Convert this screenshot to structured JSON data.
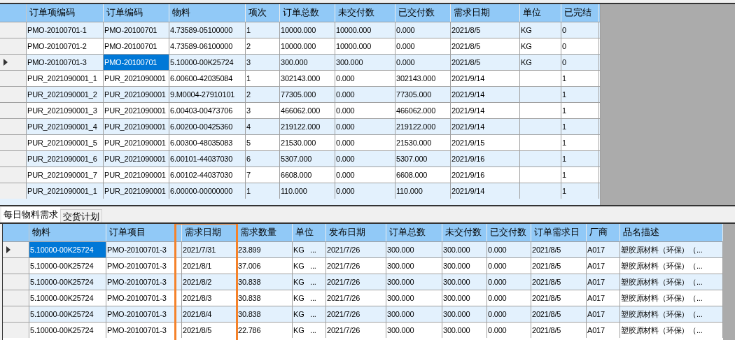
{
  "orders_grid": {
    "columns": [
      {
        "label": "订单项编码"
      },
      {
        "label": "订单编码"
      },
      {
        "label": "物料"
      },
      {
        "label": "项次"
      },
      {
        "label": "订单总数"
      },
      {
        "label": "未交付数"
      },
      {
        "label": "已交付数"
      },
      {
        "label": "需求日期"
      },
      {
        "label": "单位"
      },
      {
        "label": "已完结"
      }
    ],
    "rows": [
      {
        "selected": false,
        "cells": [
          {
            "text": "PMO-20100701-1",
            "selected": false
          },
          {
            "text": "PMO-20100701",
            "selected": false
          },
          {
            "text": "4.73589-05100000",
            "selected": false
          },
          {
            "text": "1",
            "selected": false
          },
          {
            "text": "10000.000",
            "selected": false
          },
          {
            "text": "10000.000",
            "selected": false
          },
          {
            "text": "0.000",
            "selected": false
          },
          {
            "text": "2021/8/5",
            "selected": false
          },
          {
            "text": "KG",
            "selected": false
          },
          {
            "text": "0",
            "selected": false
          }
        ]
      },
      {
        "selected": false,
        "cells": [
          {
            "text": "PMO-20100701-2",
            "selected": false
          },
          {
            "text": "PMO-20100701",
            "selected": false
          },
          {
            "text": "4.73589-06100000",
            "selected": false
          },
          {
            "text": "2",
            "selected": false
          },
          {
            "text": "10000.000",
            "selected": false
          },
          {
            "text": "10000.000",
            "selected": false
          },
          {
            "text": "0.000",
            "selected": false
          },
          {
            "text": "2021/8/5",
            "selected": false
          },
          {
            "text": "KG",
            "selected": false
          },
          {
            "text": "0",
            "selected": false
          }
        ]
      },
      {
        "selected": true,
        "cells": [
          {
            "text": "PMO-20100701-3",
            "selected": false
          },
          {
            "text": "PMO-20100701",
            "selected": true
          },
          {
            "text": "5.10000-00K25724",
            "selected": false
          },
          {
            "text": "3",
            "selected": false
          },
          {
            "text": "300.000",
            "selected": false
          },
          {
            "text": "300.000",
            "selected": false
          },
          {
            "text": "0.000",
            "selected": false
          },
          {
            "text": "2021/8/5",
            "selected": false
          },
          {
            "text": "KG",
            "selected": false
          },
          {
            "text": "0",
            "selected": false
          }
        ]
      },
      {
        "selected": false,
        "cells": [
          {
            "text": "PUR_2021090001_1",
            "selected": false
          },
          {
            "text": "PUR_2021090001",
            "selected": false
          },
          {
            "text": "6.00600-42035084",
            "selected": false
          },
          {
            "text": "1",
            "selected": false
          },
          {
            "text": "302143.000",
            "selected": false
          },
          {
            "text": "0.000",
            "selected": false
          },
          {
            "text": "302143.000",
            "selected": false
          },
          {
            "text": "2021/9/14",
            "selected": false
          },
          {
            "selected": false
          },
          {
            "text": "1",
            "selected": false
          }
        ]
      },
      {
        "selected": false,
        "cells": [
          {
            "text": "PUR_2021090001_2",
            "selected": false
          },
          {
            "text": "PUR_2021090001",
            "selected": false
          },
          {
            "text": "9.M0004-27910101",
            "selected": false
          },
          {
            "text": "2",
            "selected": false
          },
          {
            "text": "77305.000",
            "selected": false
          },
          {
            "text": "0.000",
            "selected": false
          },
          {
            "text": "77305.000",
            "selected": false
          },
          {
            "text": "2021/9/14",
            "selected": false
          },
          {
            "selected": false
          },
          {
            "text": "1",
            "selected": false
          }
        ]
      },
      {
        "selected": false,
        "cells": [
          {
            "text": "PUR_2021090001_3",
            "selected": false
          },
          {
            "text": "PUR_2021090001",
            "selected": false
          },
          {
            "text": "6.00403-00473706",
            "selected": false
          },
          {
            "text": "3",
            "selected": false
          },
          {
            "text": "466062.000",
            "selected": false
          },
          {
            "text": "0.000",
            "selected": false
          },
          {
            "text": "466062.000",
            "selected": false
          },
          {
            "text": "2021/9/14",
            "selected": false
          },
          {
            "selected": false
          },
          {
            "text": "1",
            "selected": false
          }
        ]
      },
      {
        "selected": false,
        "cells": [
          {
            "text": "PUR_2021090001_4",
            "selected": false
          },
          {
            "text": "PUR_2021090001",
            "selected": false
          },
          {
            "text": "6.00200-00425360",
            "selected": false
          },
          {
            "text": "4",
            "selected": false
          },
          {
            "text": "219122.000",
            "selected": false
          },
          {
            "text": "0.000",
            "selected": false
          },
          {
            "text": "219122.000",
            "selected": false
          },
          {
            "text": "2021/9/14",
            "selected": false
          },
          {
            "selected": false
          },
          {
            "text": "1",
            "selected": false
          }
        ]
      },
      {
        "selected": false,
        "cells": [
          {
            "text": "PUR_2021090001_5",
            "selected": false
          },
          {
            "text": "PUR_2021090001",
            "selected": false
          },
          {
            "text": "6.00300-48035083",
            "selected": false
          },
          {
            "text": "5",
            "selected": false
          },
          {
            "text": "21530.000",
            "selected": false
          },
          {
            "text": "0.000",
            "selected": false
          },
          {
            "text": "21530.000",
            "selected": false
          },
          {
            "text": "2021/9/15",
            "selected": false
          },
          {
            "selected": false
          },
          {
            "text": "1",
            "selected": false
          }
        ]
      },
      {
        "selected": false,
        "cells": [
          {
            "text": "PUR_2021090001_6",
            "selected": false
          },
          {
            "text": "PUR_2021090001",
            "selected": false
          },
          {
            "text": "6.00101-44037030",
            "selected": false
          },
          {
            "text": "6",
            "selected": false
          },
          {
            "text": "5307.000",
            "selected": false
          },
          {
            "text": "0.000",
            "selected": false
          },
          {
            "text": "5307.000",
            "selected": false
          },
          {
            "text": "2021/9/16",
            "selected": false
          },
          {
            "selected": false
          },
          {
            "text": "1",
            "selected": false
          }
        ]
      },
      {
        "selected": false,
        "cells": [
          {
            "text": "PUR_2021090001_7",
            "selected": false
          },
          {
            "text": "PUR_2021090001",
            "selected": false
          },
          {
            "text": "6.00102-44037030",
            "selected": false
          },
          {
            "text": "7",
            "selected": false
          },
          {
            "text": "6608.000",
            "selected": false
          },
          {
            "text": "0.000",
            "selected": false
          },
          {
            "text": "6608.000",
            "selected": false
          },
          {
            "text": "2021/9/16",
            "selected": false
          },
          {
            "selected": false
          },
          {
            "text": "1",
            "selected": false
          }
        ]
      },
      {
        "selected": false,
        "cells": [
          {
            "text": "PUR_2021090001_1",
            "selected": false
          },
          {
            "text": "PUR_2021090001",
            "selected": false
          },
          {
            "text": "6.00000-00000000",
            "selected": false
          },
          {
            "text": "1",
            "selected": false
          },
          {
            "text": "110.000",
            "selected": false
          },
          {
            "text": "0.000",
            "selected": false
          },
          {
            "text": "110.000",
            "selected": false
          },
          {
            "text": "2021/9/14",
            "selected": false
          },
          {
            "selected": false
          },
          {
            "text": "1",
            "selected": false
          }
        ]
      }
    ]
  },
  "tabs": [
    {
      "label": "每日物料需求",
      "selected": true
    },
    {
      "label": "交货计划",
      "selected": false
    }
  ],
  "demand_grid": {
    "columns": [
      {
        "label": "物料"
      },
      {
        "label": "订单项目"
      },
      {},
      {
        "label": "需求日期"
      },
      {
        "label": "需求数量"
      },
      {
        "label": "单位"
      },
      {
        "label": "发布日期"
      },
      {
        "label": "订单总数"
      },
      {
        "label": "未交付数"
      },
      {
        "label": "已交付数"
      },
      {
        "label": "订单需求日"
      },
      {
        "label": "厂商"
      },
      {
        "label": "品名描述"
      }
    ],
    "rows": [
      {
        "selected": true,
        "cells": [
          {
            "text": "5.10000-00K25724",
            "selected": true
          },
          {
            "text": "PMO-20100701-3",
            "selected": false
          },
          {
            "selected": false
          },
          {
            "text": "2021/7/31",
            "selected": false
          },
          {
            "text": "23.899",
            "selected": false
          },
          {
            "text": "KG   ...",
            "selected": false
          },
          {
            "text": "2021/7/26",
            "selected": false
          },
          {
            "text": "300.000",
            "selected": false
          },
          {
            "text": "300.000",
            "selected": false
          },
          {
            "text": "0.000",
            "selected": false
          },
          {
            "text": "2021/8/5",
            "selected": false
          },
          {
            "text": "A017",
            "selected": false
          },
          {
            "text": "塑胶原材料（环保）（...",
            "selected": false
          }
        ]
      },
      {
        "selected": false,
        "cells": [
          {
            "text": "5.10000-00K25724",
            "selected": false
          },
          {
            "text": "PMO-20100701-3",
            "selected": false
          },
          {
            "selected": false
          },
          {
            "text": "2021/8/1",
            "selected": false
          },
          {
            "text": "37.006",
            "selected": false
          },
          {
            "text": "KG   ...",
            "selected": false
          },
          {
            "text": "2021/7/26",
            "selected": false
          },
          {
            "text": "300.000",
            "selected": false
          },
          {
            "text": "300.000",
            "selected": false
          },
          {
            "text": "0.000",
            "selected": false
          },
          {
            "text": "2021/8/5",
            "selected": false
          },
          {
            "text": "A017",
            "selected": false
          },
          {
            "text": "塑胶原材料（环保）（...",
            "selected": false
          }
        ]
      },
      {
        "selected": false,
        "cells": [
          {
            "text": "5.10000-00K25724",
            "selected": false
          },
          {
            "text": "PMO-20100701-3",
            "selected": false
          },
          {
            "selected": false
          },
          {
            "text": "2021/8/2",
            "selected": false
          },
          {
            "text": "30.838",
            "selected": false
          },
          {
            "text": "KG   ...",
            "selected": false
          },
          {
            "text": "2021/7/26",
            "selected": false
          },
          {
            "text": "300.000",
            "selected": false
          },
          {
            "text": "300.000",
            "selected": false
          },
          {
            "text": "0.000",
            "selected": false
          },
          {
            "text": "2021/8/5",
            "selected": false
          },
          {
            "text": "A017",
            "selected": false
          },
          {
            "text": "塑胶原材料（环保）（...",
            "selected": false
          }
        ]
      },
      {
        "selected": false,
        "cells": [
          {
            "text": "5.10000-00K25724",
            "selected": false
          },
          {
            "text": "PMO-20100701-3",
            "selected": false
          },
          {
            "selected": false
          },
          {
            "text": "2021/8/3",
            "selected": false
          },
          {
            "text": "30.838",
            "selected": false
          },
          {
            "text": "KG   ...",
            "selected": false
          },
          {
            "text": "2021/7/26",
            "selected": false
          },
          {
            "text": "300.000",
            "selected": false
          },
          {
            "text": "300.000",
            "selected": false
          },
          {
            "text": "0.000",
            "selected": false
          },
          {
            "text": "2021/8/5",
            "selected": false
          },
          {
            "text": "A017",
            "selected": false
          },
          {
            "text": "塑胶原材料（环保）（...",
            "selected": false
          }
        ]
      },
      {
        "selected": false,
        "cells": [
          {
            "text": "5.10000-00K25724",
            "selected": false
          },
          {
            "text": "PMO-20100701-3",
            "selected": false
          },
          {
            "selected": false
          },
          {
            "text": "2021/8/4",
            "selected": false
          },
          {
            "text": "30.838",
            "selected": false
          },
          {
            "text": "KG   ...",
            "selected": false
          },
          {
            "text": "2021/7/26",
            "selected": false
          },
          {
            "text": "300.000",
            "selected": false
          },
          {
            "text": "300.000",
            "selected": false
          },
          {
            "text": "0.000",
            "selected": false
          },
          {
            "text": "2021/8/5",
            "selected": false
          },
          {
            "text": "A017",
            "selected": false
          },
          {
            "text": "塑胶原材料（环保）（...",
            "selected": false
          }
        ]
      },
      {
        "selected": false,
        "cells": [
          {
            "text": "5.10000-00K25724",
            "selected": false
          },
          {
            "text": "PMO-20100701-3",
            "selected": false
          },
          {
            "selected": false
          },
          {
            "text": "2021/8/5",
            "selected": false
          },
          {
            "text": "22.786",
            "selected": false
          },
          {
            "text": "KG   ...",
            "selected": false
          },
          {
            "text": "2021/7/26",
            "selected": false
          },
          {
            "text": "300.000",
            "selected": false
          },
          {
            "text": "300.000",
            "selected": false
          },
          {
            "text": "0.000",
            "selected": false
          },
          {
            "text": "2021/8/5",
            "selected": false
          },
          {
            "text": "A017",
            "selected": false
          },
          {
            "text": "塑胶原材料（环保）（...",
            "selected": false
          }
        ]
      }
    ]
  }
}
